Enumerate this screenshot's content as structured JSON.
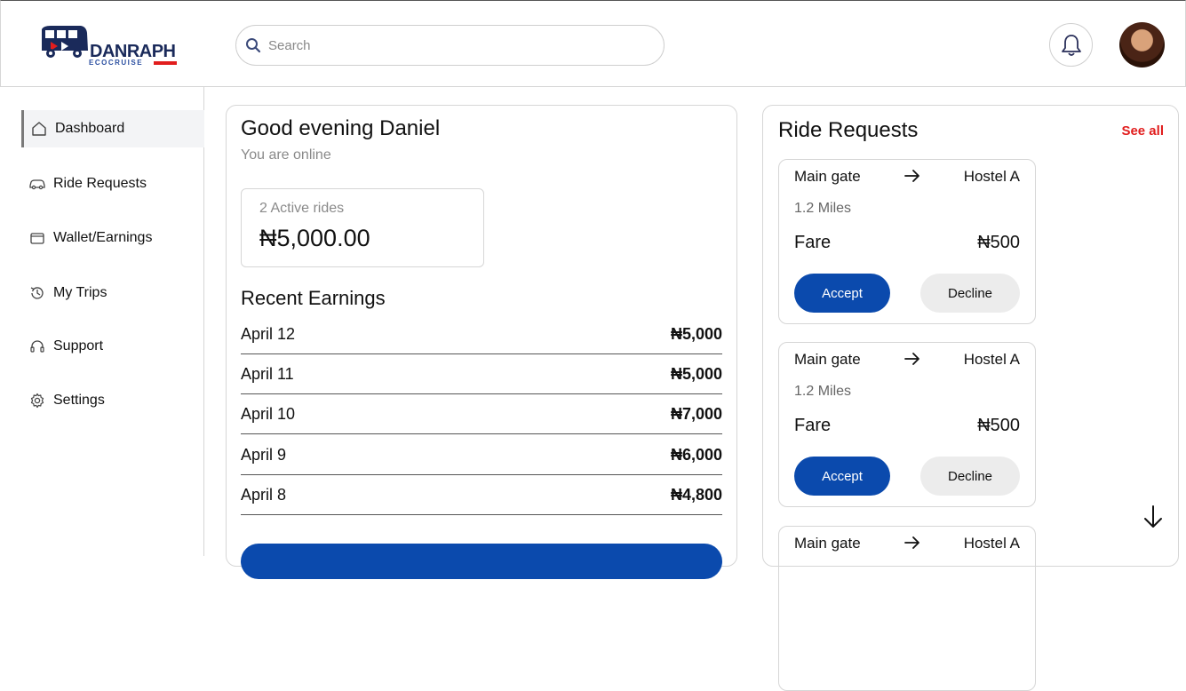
{
  "brand": {
    "name": "DANRAPH",
    "sub": "ECOCRUISE"
  },
  "search": {
    "placeholder": "Search"
  },
  "sidebar": {
    "items": [
      {
        "label": "Dashboard",
        "icon": "home-icon"
      },
      {
        "label": "Ride Requests",
        "icon": "car-icon"
      },
      {
        "label": "Wallet/Earnings",
        "icon": "wallet-icon"
      },
      {
        "label": "My Trips",
        "icon": "history-icon"
      },
      {
        "label": "Support",
        "icon": "headset-icon"
      },
      {
        "label": "Settings",
        "icon": "gear-icon"
      }
    ]
  },
  "main": {
    "greeting": "Good evening Daniel",
    "status": "You are online",
    "active_rides": "2 Active rides",
    "balance": "₦5,000.00",
    "recent_title": "Recent Earnings",
    "earnings": [
      {
        "date": "April 12",
        "amount": "₦5,000"
      },
      {
        "date": "April 11",
        "amount": "₦5,000"
      },
      {
        "date": "April 10",
        "amount": "₦7,000"
      },
      {
        "date": "April 9",
        "amount": "₦6,000"
      },
      {
        "date": "April 8",
        "amount": "₦4,800"
      }
    ]
  },
  "rides": {
    "title": "Ride Requests",
    "see_all": "See all",
    "requests": [
      {
        "from": "Main gate",
        "to": "Hostel A",
        "distance": "1.2 Miles",
        "fare_label": "Fare",
        "fare": "₦500",
        "accept": "Accept",
        "decline": "Decline"
      },
      {
        "from": "Main gate",
        "to": "Hostel A",
        "distance": "1.2 Miles",
        "fare_label": "Fare",
        "fare": "₦500",
        "accept": "Accept",
        "decline": "Decline"
      },
      {
        "from": "Main gate",
        "to": "Hostel A"
      }
    ]
  },
  "colors": {
    "primary": "#0b4aad",
    "accent_red": "#e11d1d",
    "muted": "#8a8a8a"
  }
}
